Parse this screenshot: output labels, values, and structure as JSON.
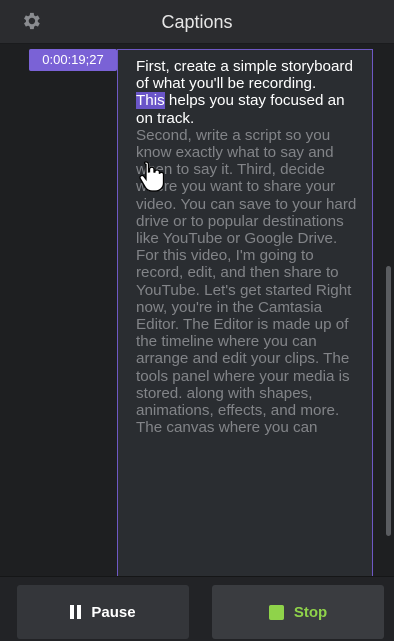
{
  "header": {
    "title": "Captions",
    "settings_icon": "gear-icon"
  },
  "caption": {
    "timestamp": "0:00:19;27",
    "active_text": "First, create a simple storyboard of what you'll be recording.",
    "selected_word": "This",
    "active_text_2": " helps you stay focused an on track.",
    "upcoming_text": "Second, write a script so you know exactly what to say and when to say it. Third, decide where you want to share your video. You can save to your hard drive or to popular destinations like YouTube or Google Drive. For this video, I'm going to record, edit, and then share to YouTube. Let's get started Right now, you're in the Camtasia Editor. The Editor is made up of the timeline where you can arrange and edit your clips. The tools panel where your media is stored. along with shapes, animations, effects, and more. The canvas where you can"
  },
  "footer": {
    "pause_label": "Pause",
    "stop_label": "Stop"
  },
  "colors": {
    "accent": "#7a62d6",
    "stop_green": "#8fd34a",
    "background": "#1e1f21"
  }
}
